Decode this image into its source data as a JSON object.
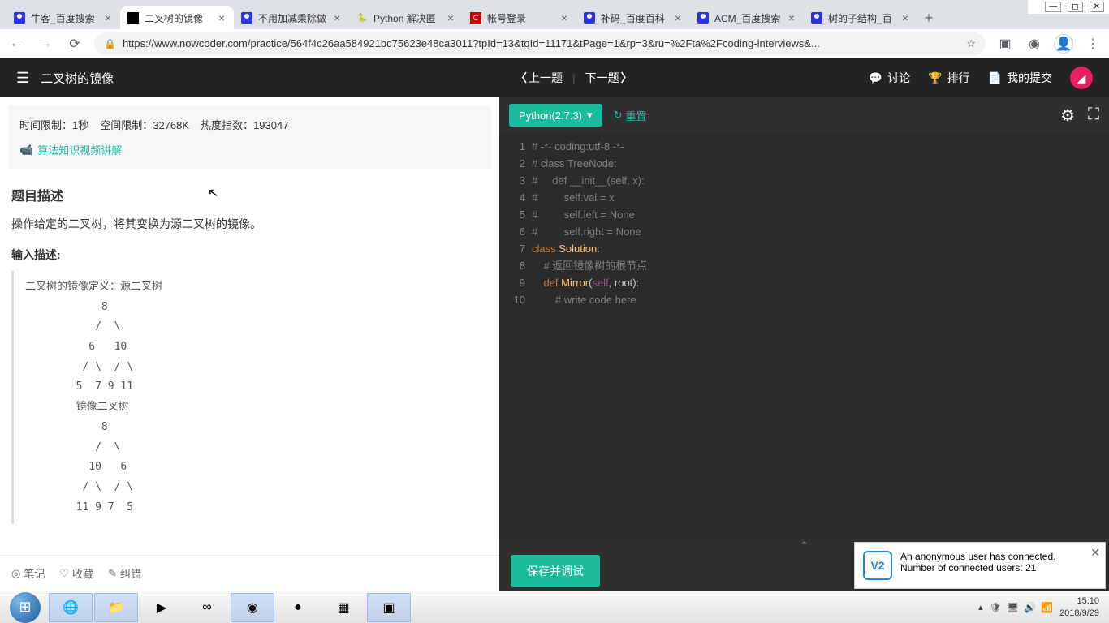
{
  "window": {
    "min": "—",
    "max": "◻",
    "close": "✕"
  },
  "tabs": [
    {
      "title": "牛客_百度搜索",
      "icon": "baidu"
    },
    {
      "title": "二叉树的镜像",
      "icon": "nc",
      "active": true
    },
    {
      "title": "不用加减乘除做",
      "icon": "baidu"
    },
    {
      "title": "Python 解决匿",
      "icon": "py"
    },
    {
      "title": "帐号登录",
      "icon": "c"
    },
    {
      "title": "补码_百度百科",
      "icon": "baidu"
    },
    {
      "title": "ACM_百度搜索",
      "icon": "baidu"
    },
    {
      "title": "树的子结构_百",
      "icon": "baidu"
    }
  ],
  "url": "https://www.nowcoder.com/practice/564f4c26aa584921bc75623e48ca3011?tpId=13&tqId=11171&tPage=1&rp=3&ru=%2Fta%2Fcoding-interviews&...",
  "problem": {
    "title": "二叉树的镜像",
    "time_limit": "时间限制：1秒",
    "space_limit": "空间限制：32768K",
    "heat": "热度指数：193047",
    "video_link": "算法知识视频讲解",
    "desc_title": "题目描述",
    "desc_text": "操作给定的二叉树，将其变换为源二叉树的镜像。",
    "input_title": "输入描述:",
    "input_block": "二叉树的镜像定义：源二叉树 \n    \t    8\n    \t   /  \\\n    \t  6   10\n    \t / \\  / \\\n    \t5  7 9 11\n    \t镜像二叉树\n    \t    8\n    \t   /  \\\n    \t  10   6\n    \t / \\  / \\\n    \t11 9 7  5"
  },
  "left_footer": {
    "note": "笔记",
    "fav": "收藏",
    "err": "纠错"
  },
  "nav": {
    "prev": "上一题",
    "next": "下一题"
  },
  "actions": {
    "discuss": "讨论",
    "rank": "排行",
    "submit": "我的提交"
  },
  "lang": "Python(2.7.3)",
  "reset": "重置",
  "code": {
    "lines": [
      {
        "n": 1,
        "html": "<span class='c-comment'># -*- coding:utf-8 -*-</span>"
      },
      {
        "n": 2,
        "html": "<span class='c-comment'># class TreeNode:</span>"
      },
      {
        "n": 3,
        "html": "<span class='c-comment'>#     def __init__(self, x):</span>"
      },
      {
        "n": 4,
        "html": "<span class='c-comment'>#         self.val = x</span>"
      },
      {
        "n": 5,
        "html": "<span class='c-comment'>#         self.left = None</span>"
      },
      {
        "n": 6,
        "html": "<span class='c-comment'>#         self.right = None</span>"
      },
      {
        "n": 7,
        "html": "<span class='c-keyword'>class</span> <span class='c-func'>Solution</span>:"
      },
      {
        "n": 8,
        "html": "    <span class='c-comment'># 返回镜像树的根节点</span>"
      },
      {
        "n": 9,
        "html": "    <span class='c-keyword'>def</span> <span class='c-func'>Mirror</span>(<span class='c-self'>self</span>, root):"
      },
      {
        "n": 10,
        "html": "        <span class='c-comment'># write code here</span>"
      }
    ]
  },
  "save_btn": "保存并调试",
  "notification": {
    "line1": "An anonymous user has connected.",
    "line2": "Number of connected users: 21",
    "icon": "V2"
  },
  "clock": {
    "time": "15:10",
    "date": "2018/9/29"
  }
}
